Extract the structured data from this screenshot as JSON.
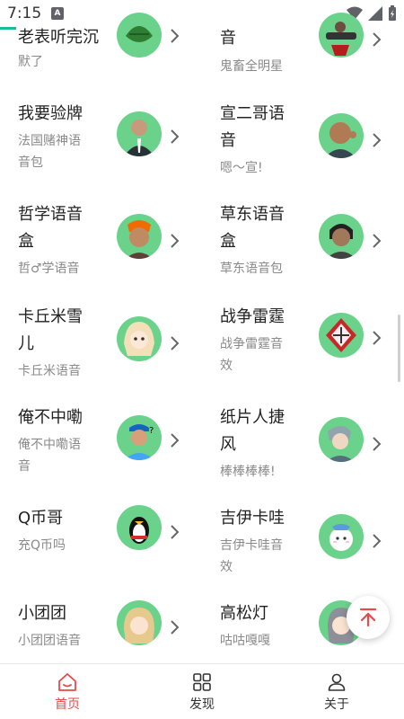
{
  "status_bar": {
    "time": "7:15",
    "notification_letter": "A"
  },
  "accent_color": "#e64a4a",
  "avatar_bg_color": "#6ad28a",
  "items": [
    {
      "title": "老表听完沉默了",
      "subtitle": "",
      "avatar_icon": "leaf-avatar-icon"
    },
    {
      "title": "音",
      "subtitle": "鬼畜全明星",
      "avatar_icon": "gunman-avatar-icon"
    },
    {
      "title": "我要验牌",
      "subtitle": "法国赌神语音包",
      "avatar_icon": "suited-man-avatar-icon"
    },
    {
      "title": "宣二哥语音",
      "subtitle": "嗯～宣!",
      "avatar_icon": "bald-man-avatar-icon"
    },
    {
      "title": "哲学语音盒",
      "subtitle": "哲♂学语音",
      "avatar_icon": "orange-hair-man-avatar-icon"
    },
    {
      "title": "草东语音盒",
      "subtitle": "草东语音包",
      "avatar_icon": "singer-avatar-icon"
    },
    {
      "title": "卡丘米雪儿",
      "subtitle": "卡丘米语音",
      "avatar_icon": "anime-girl-avatar-icon"
    },
    {
      "title": "战争雷霆",
      "subtitle": "战争雷霆音效",
      "avatar_icon": "war-thunder-avatar-icon"
    },
    {
      "title": "俺不中嘞",
      "subtitle": "俺不中嘞语音",
      "avatar_icon": "confused-man-avatar-icon"
    },
    {
      "title": "纸片人捷风",
      "subtitle": "棒棒棒棒!",
      "avatar_icon": "jett-avatar-icon"
    },
    {
      "title": "Q币哥",
      "subtitle": "充Q币吗",
      "avatar_icon": "penguin-avatar-icon"
    },
    {
      "title": "吉伊卡哇",
      "subtitle": "吉伊卡哇音效",
      "avatar_icon": "chiikawa-avatar-icon"
    },
    {
      "title": "小团团",
      "subtitle": "小团团语音",
      "avatar_icon": "blonde-girl-avatar-icon"
    },
    {
      "title": "高松灯",
      "subtitle": "咕咕嘎嘎",
      "avatar_icon": "gray-hair-girl-avatar-icon"
    }
  ],
  "display_lines": {
    "i0_title": [
      "老表听完沉",
      "默了"
    ],
    "i1_title": [
      "音"
    ],
    "i2_title": [
      "我要验牌"
    ],
    "i2_sub": [
      "法国赌神语",
      "音包"
    ],
    "i3_title": [
      "宣二哥语",
      "音"
    ],
    "i4_title": [
      "哲学语音",
      "盒"
    ],
    "i5_title": [
      "草东语音",
      "盒"
    ],
    "i6_title": [
      "卡丘米雪",
      "儿"
    ],
    "i7_sub": [
      "战争雷霆音",
      "效"
    ],
    "i8_sub": [
      "俺不中嘞语",
      "音"
    ],
    "i9_title": [
      "纸片人捷",
      "风"
    ],
    "i11_sub": [
      "吉伊卡哇音",
      "效"
    ]
  },
  "nav": [
    {
      "label": "首页",
      "icon": "home-icon",
      "active": true
    },
    {
      "label": "发现",
      "icon": "grid-icon",
      "active": false
    },
    {
      "label": "关于",
      "icon": "person-icon",
      "active": false
    }
  ],
  "fab_icon": "back-to-top-icon"
}
